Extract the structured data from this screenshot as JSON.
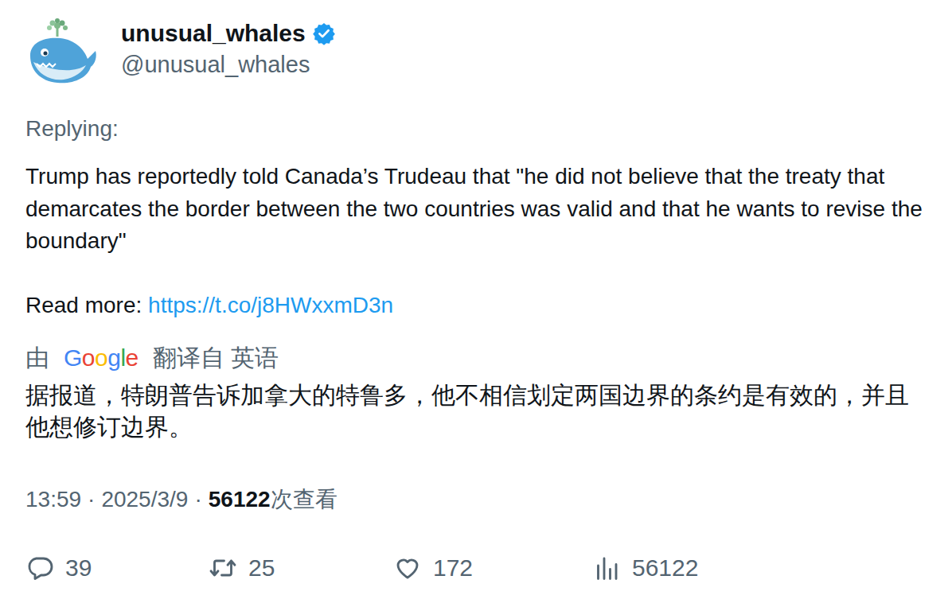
{
  "author": {
    "name": "unusual_whales",
    "handle": "@unusual_whales",
    "verified": true
  },
  "reply_label": "Replying:",
  "body": "Trump has reportedly told Canada’s Trudeau that \"he did not believe that the treaty that demarcates the border between the two countries was valid and that he wants to revise the boundary\"",
  "read_more": {
    "label": "Read more: ",
    "link": "https://t.co/j8HWxxmD3n"
  },
  "translation": {
    "prefix": "由",
    "provider": "Google",
    "source": "翻译自 英语",
    "text": "据报道，特朗普告诉加拿大的特鲁多，他不相信划定两国边界的条约是有效的，并且他想修订边界。"
  },
  "meta": {
    "time": "13:59",
    "separator": "·",
    "date": "2025/3/9",
    "views": "56122",
    "views_label": "次查看"
  },
  "actions": [
    {
      "kind": "reply",
      "count": "39"
    },
    {
      "kind": "retweet",
      "count": "25"
    },
    {
      "kind": "like",
      "count": "172"
    },
    {
      "kind": "views",
      "count": "56122"
    }
  ]
}
